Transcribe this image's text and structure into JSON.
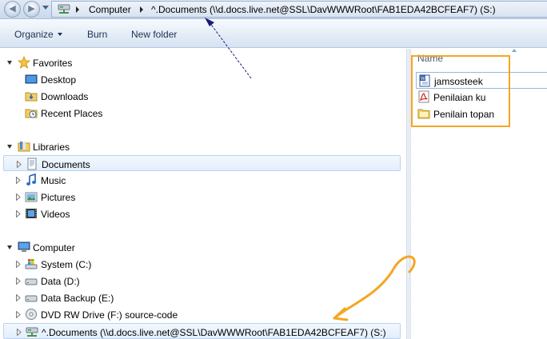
{
  "address_bar": {
    "crumbs": [
      "Computer",
      "^.Documents (\\\\d.docs.live.net@SSL\\DavWWWRoot\\FAB1EDA42BCFEAF7) (S:)"
    ]
  },
  "toolbar": {
    "organize_label": "Organize",
    "burn_label": "Burn",
    "new_folder_label": "New folder"
  },
  "nav": {
    "favorites": {
      "label": "Favorites",
      "items": [
        {
          "label": "Desktop",
          "icon": "desktop-icon"
        },
        {
          "label": "Downloads",
          "icon": "downloads-folder-icon"
        },
        {
          "label": "Recent Places",
          "icon": "recent-places-icon"
        }
      ]
    },
    "libraries": {
      "label": "Libraries",
      "items": [
        {
          "label": "Documents",
          "icon": "documents-library-icon",
          "selected": true
        },
        {
          "label": "Music",
          "icon": "music-library-icon"
        },
        {
          "label": "Pictures",
          "icon": "pictures-library-icon"
        },
        {
          "label": "Videos",
          "icon": "videos-library-icon"
        }
      ]
    },
    "computer": {
      "label": "Computer",
      "items": [
        {
          "label": "System (C:)",
          "icon": "system-drive-icon"
        },
        {
          "label": "Data (D:)",
          "icon": "hard-drive-icon"
        },
        {
          "label": "Data Backup (E:)",
          "icon": "hard-drive-icon"
        },
        {
          "label": "DVD RW Drive (F:) source-code",
          "icon": "dvd-drive-icon"
        },
        {
          "label": "^.Documents (\\\\d.docs.live.net@SSL\\DavWWWRoot\\FAB1EDA42BCFEAF7) (S:)",
          "icon": "network-drive-icon"
        }
      ]
    }
  },
  "content": {
    "column_header": "Name",
    "files": [
      {
        "name": "jamsosteek",
        "icon": "word-document-icon"
      },
      {
        "name": "Penilaian ku",
        "icon": "pdf-document-icon"
      },
      {
        "name": "Penilain topan",
        "icon": "folder-icon"
      }
    ]
  },
  "colors": {
    "annotation_orange": "#f5a623",
    "annotation_navy": "#1a1a7a",
    "selection_border": "#b8d3f3"
  }
}
